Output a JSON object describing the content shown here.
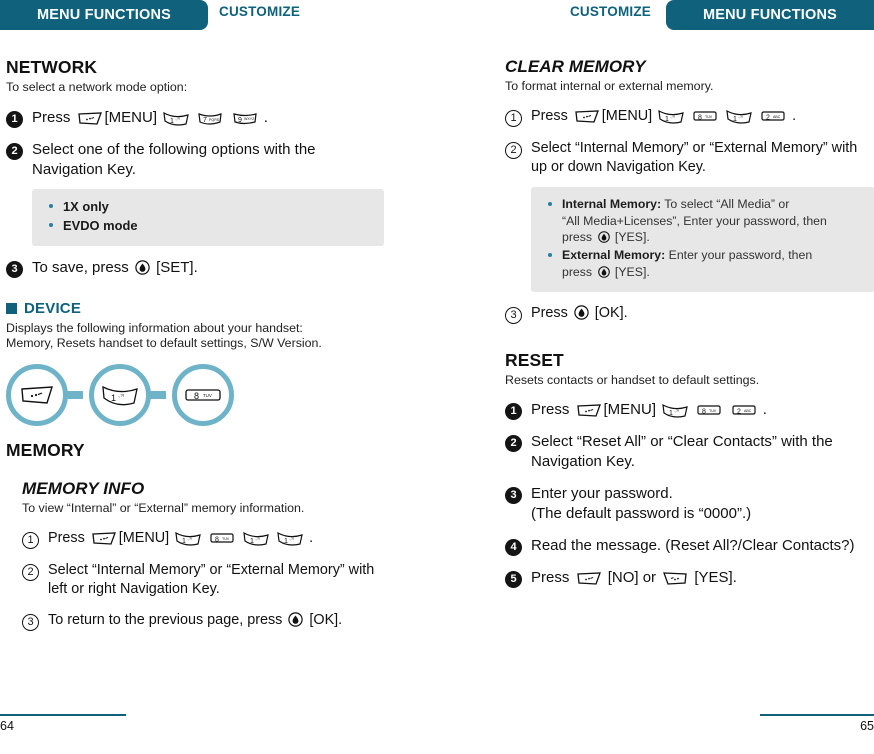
{
  "header": {
    "left_banner": "MENU FUNCTIONS",
    "left_crumb": "CUSTOMIZE",
    "right_banner": "MENU FUNCTIONS",
    "right_crumb": "CUSTOMIZE",
    "banner_color": "#0f617c",
    "accent_color": "#6eb3c8"
  },
  "left_page": {
    "network": {
      "title": "NETWORK",
      "desc": "To select a network mode option:",
      "step1_pre": "Press",
      "step1_menu": "[MENU]",
      "step1_keys": [
        "1",
        "7",
        "9"
      ],
      "step1_end": ".",
      "step2": "Select one of the following options with the Navigation Key.",
      "options": [
        "1X only",
        "EVDO mode"
      ],
      "step3_pre": "To save, press",
      "step3_post": "[SET]."
    },
    "device": {
      "title": "DEVICE",
      "desc_line1": "Displays the following information about your handset:",
      "desc_line2": "Memory, Resets handset to default settings, S/W Version.",
      "diagram_keys": [
        "menu",
        "1",
        "8"
      ]
    },
    "memory": {
      "title": "MEMORY"
    },
    "memory_info": {
      "title": "MEMORY INFO",
      "desc": "To view “Internal” or “External” memory information.",
      "step1_pre": "Press",
      "step1_menu": "[MENU]",
      "step1_keys": [
        "1",
        "8",
        "1",
        "1"
      ],
      "step1_end": ".",
      "step2": "Select “Internal Memory” or “External Memory” with left or right Navigation Key.",
      "step3_pre": "To return to the previous page, press",
      "step3_post": "[OK]."
    },
    "page_number": "64"
  },
  "right_page": {
    "clear_memory": {
      "title": "CLEAR MEMORY",
      "desc": "To format internal or external memory.",
      "step1_pre": "Press",
      "step1_menu": "[MENU]",
      "step1_keys": [
        "1",
        "8",
        "1",
        "2"
      ],
      "step1_end": ".",
      "step2": "Select “Internal Memory” or “External Memory” with up or down Navigation Key.",
      "note_internal_label": "Internal Memory:",
      "note_internal_line1": "To select “All Media” or",
      "note_internal_line2": "“All Media+Licenses”, Enter your password, then",
      "note_internal_press": "press",
      "note_internal_yes": "[YES].",
      "note_external_label": "External Memory:",
      "note_external_line1": "Enter your password, then",
      "note_external_press": "press",
      "note_external_yes": "[YES].",
      "step3_pre": "Press",
      "step3_post": "[OK]."
    },
    "reset": {
      "title": "RESET",
      "desc": "Resets contacts or handset to default settings.",
      "step1_pre": "Press",
      "step1_menu": "[MENU]",
      "step1_keys": [
        "1",
        "8",
        "2"
      ],
      "step1_end": ".",
      "step2": "Select “Reset All” or “Clear Contacts” with the Navigation Key.",
      "step3_line1": "Enter your password.",
      "step3_line2": "(The default password is “0000”.)",
      "step4": "Read the message. (Reset All?/Clear Contacts?)",
      "step5_pre": "Press",
      "step5_no": "[NO] or",
      "step5_yes": "[YES]."
    },
    "page_number": "65"
  }
}
